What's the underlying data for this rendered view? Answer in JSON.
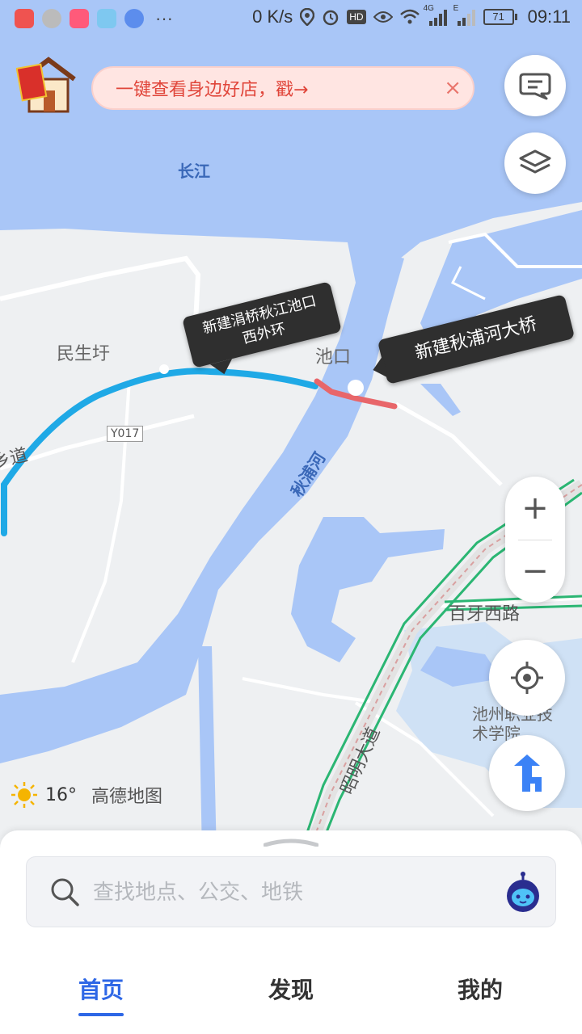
{
  "status": {
    "speed": "0 K/s",
    "signal_4g": "4G",
    "signal_e": "E",
    "battery": "71",
    "time": "09:11",
    "dots": "···",
    "hd": "HD"
  },
  "promo": {
    "text": "一键查看身边好店，戳→",
    "close_label": "×",
    "logo_text": "网红店"
  },
  "map": {
    "labels": {
      "river_changjiang": "长江",
      "river_qiupu": "秋浦河",
      "village": "民生圩",
      "town": "池口",
      "road_code": "Y017",
      "road_xiang": "乡道",
      "road_baiya": "百牙西路",
      "road_zhaoming": "昭明大道",
      "college": "池州职业技术学院"
    },
    "callouts": {
      "left": "新建涓桥秋江池口西外环",
      "right": "新建秋浦河大桥"
    },
    "colors": {
      "water": "#a9c6f7",
      "land": "#eef0f2",
      "route_blue": "#1fa9e6",
      "route_red": "#e8666a",
      "rail_green": "#2bb673"
    }
  },
  "controls": {
    "zoom_in": "+",
    "zoom_out": "−"
  },
  "weather": {
    "temp": "16°",
    "brand": "高德地图"
  },
  "search": {
    "placeholder": "查找地点、公交、地铁"
  },
  "tabs": [
    {
      "label": "首页",
      "active": true
    },
    {
      "label": "发现",
      "active": false
    },
    {
      "label": "我的",
      "active": false
    }
  ]
}
